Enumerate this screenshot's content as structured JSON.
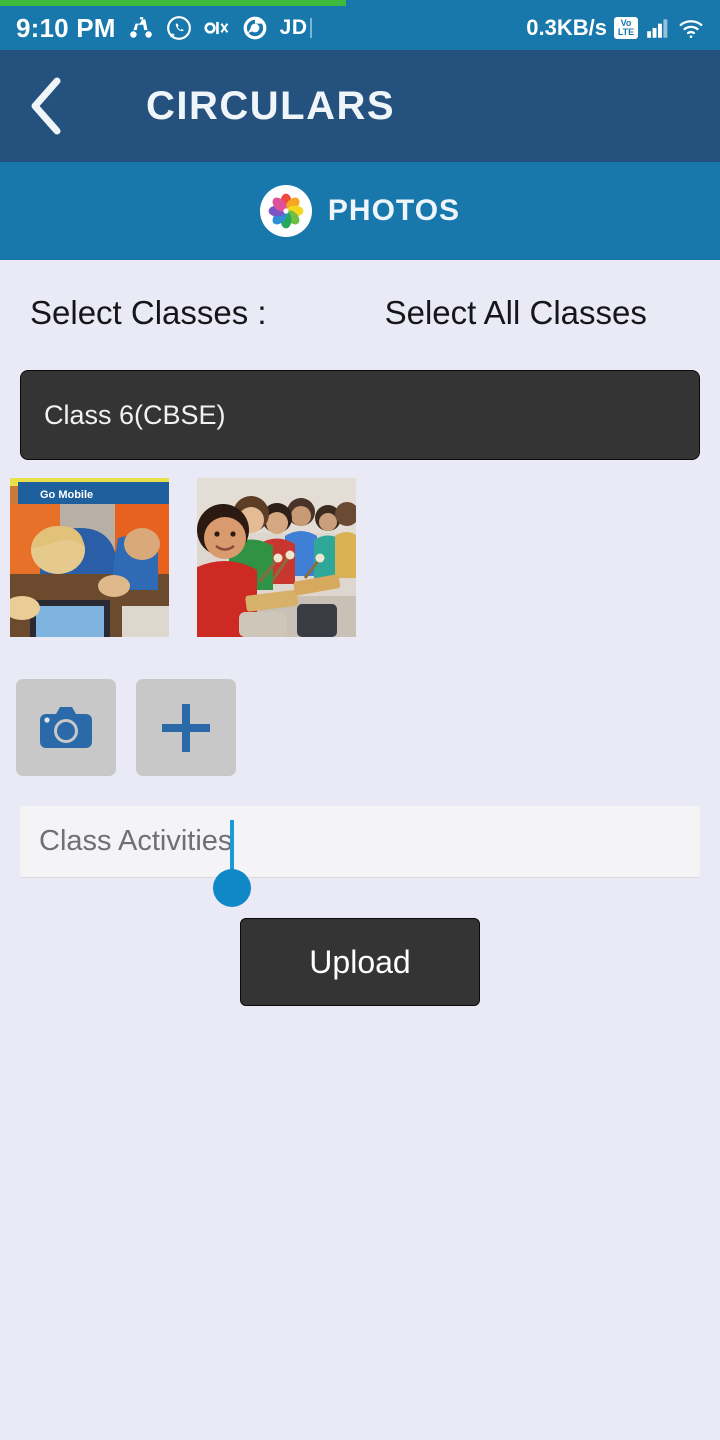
{
  "statusbar": {
    "time": "9:10 PM",
    "net_speed": "0.3KB/s",
    "volte_top": "Vo",
    "volte_bottom": "LTE",
    "jd_label": "JD",
    "icons": [
      "scooter-icon",
      "whatsapp-icon",
      "olx-icon",
      "chrome-icon"
    ],
    "background": "#1878ac"
  },
  "loading": {
    "progress_percent": 48,
    "color": "#3dbb3d"
  },
  "titlebar": {
    "title": "CIRCULARS",
    "back_icon": "back-chevron-icon",
    "background": "#25517e"
  },
  "tab": {
    "label": "PHOTOS",
    "icon": "photos-flower-icon",
    "background": "#1878ac"
  },
  "form": {
    "select_classes_label": "Select Classes :",
    "select_all_label": "Select All Classes",
    "class_selected": "Class 6(CBSE)",
    "thumbnails": [
      {
        "name": "students-laptops-photo",
        "banner_text": "Go Mobile"
      },
      {
        "name": "children-xylophone-photo",
        "banner_text": ""
      }
    ],
    "camera_button_icon": "camera-icon",
    "add_button_icon": "plus-icon",
    "caption_value": "Class Activities",
    "caption_placeholder": "Class Activities",
    "upload_label": "Upload"
  },
  "colors": {
    "page_background": "#eaeaf6",
    "dark_control": "#343434",
    "accent_blue": "#1878ac",
    "caret_blue": "#1088c8"
  }
}
